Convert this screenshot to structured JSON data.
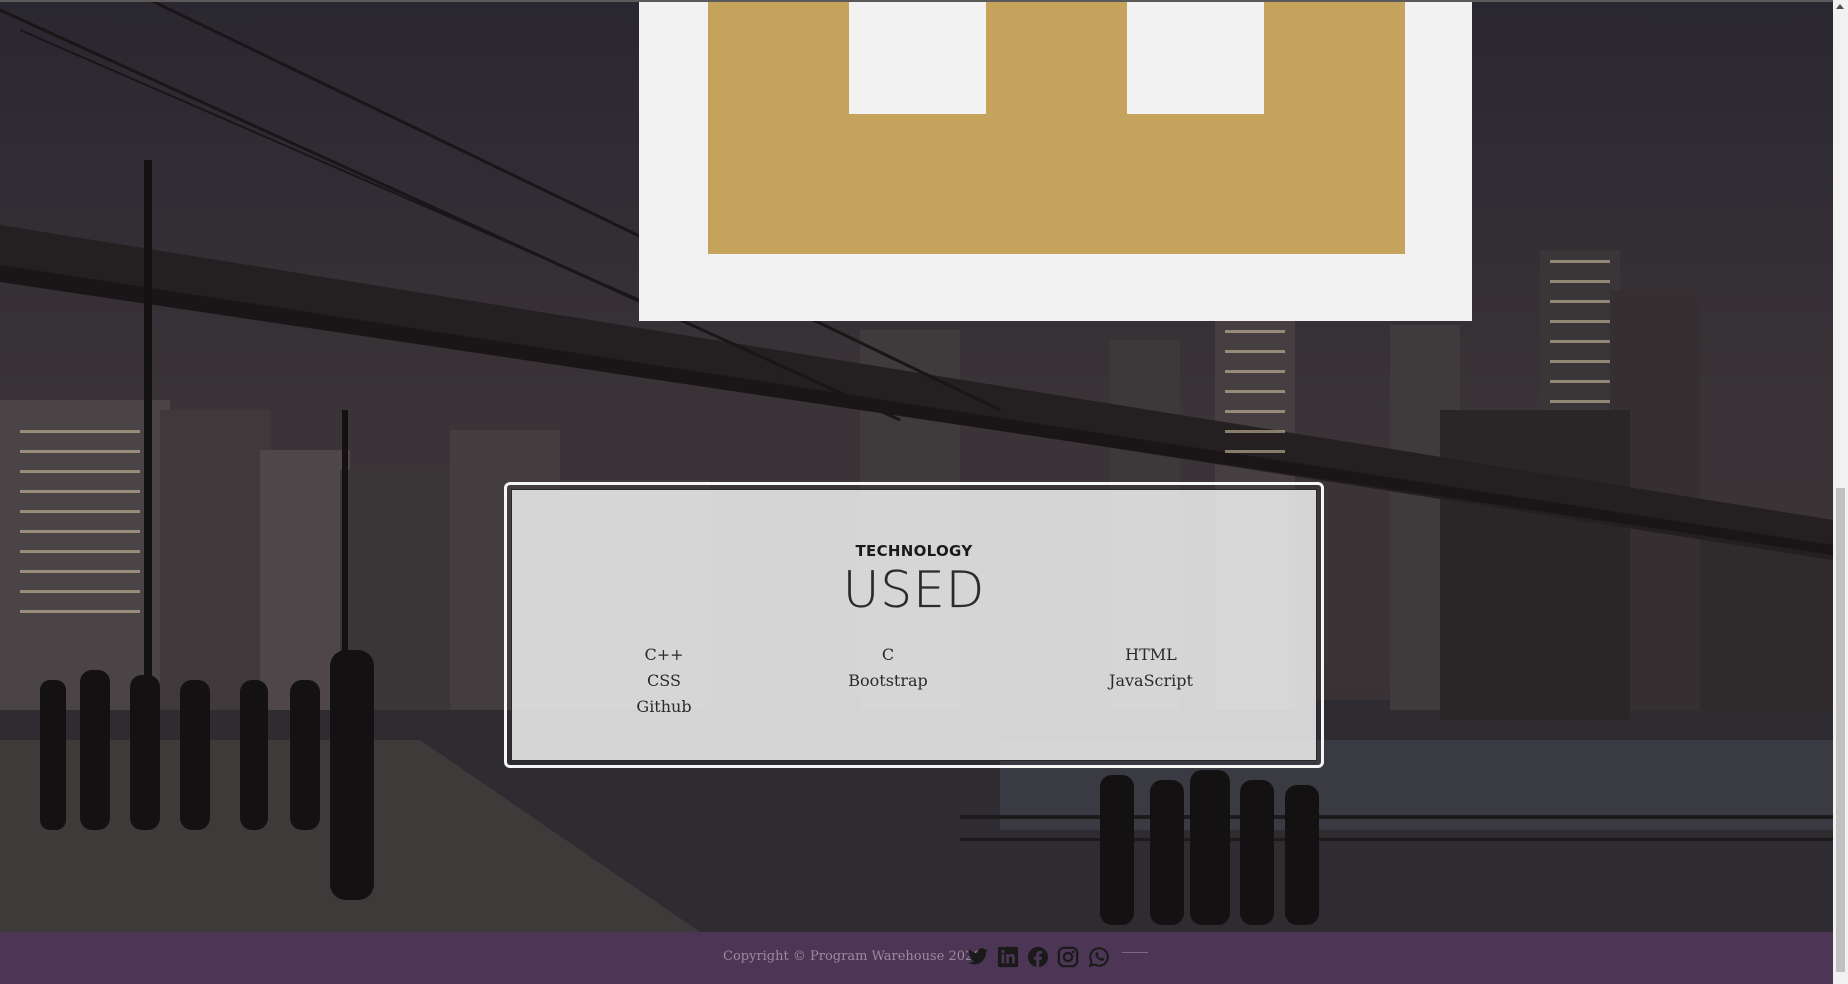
{
  "tech": {
    "heading": "TECHNOLOGY",
    "subheading": "USED",
    "columns": [
      [
        "C++",
        "CSS",
        "Github"
      ],
      [
        "C",
        "Bootstrap"
      ],
      [
        "HTML",
        "JavaScript"
      ]
    ]
  },
  "footer": {
    "copyright": "Copyright © Program Warehouse 2020",
    "social_icons": [
      "twitter-icon",
      "linkedin-icon",
      "facebook-icon",
      "instagram-icon",
      "whatsapp-icon"
    ]
  },
  "colors": {
    "logo_gold": "#c5a35d",
    "card_bg": "#f2f2f2",
    "footer_bg": "#4d3655",
    "social_icon": "#1a1a1a"
  }
}
